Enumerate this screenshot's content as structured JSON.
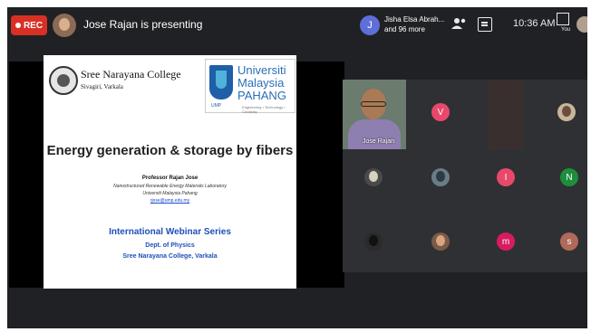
{
  "rec": {
    "label": "REC"
  },
  "presenter": {
    "text": "Jose Rajan is presenting"
  },
  "viewers": {
    "initial": "J",
    "line1": "Jisha Elsa Abrah...",
    "line2": "and 96 more"
  },
  "toolbar": {
    "time": "10:36 AM",
    "self_label": "You"
  },
  "slide": {
    "college_name": "Sree Narayana College",
    "college_place": "Sivagiri, Varkala",
    "ump_text_1": "Universiti",
    "ump_text_2": "Malaysia",
    "ump_text_3": "PAHANG",
    "ump_logo_label": "UMP",
    "ump_tagline": "Engineering • Technology • Creativity",
    "title": "Energy generation & storage by fibers",
    "author": "Professor Rajan Jose",
    "lab": "Nanostructured Renewable Energy Materials Laboratory",
    "university": "Universiti Malaysia Pahang",
    "email": "rjose@ump.edu.my",
    "series": "International Webinar Series",
    "dept": "Dept. of Physics",
    "college_footer": "Sree Narayana College, Varkala"
  },
  "grid": {
    "video_tile_name": "Jose Rajan",
    "tiles": [
      {
        "kind": "letter",
        "text": "V",
        "color": "#e8496a"
      },
      {
        "kind": "letter",
        "text": "I",
        "color": "#e8496a"
      },
      {
        "kind": "letter",
        "text": "N",
        "color": "#1e8e3e"
      },
      {
        "kind": "letter",
        "text": "m",
        "color": "#d81b60"
      },
      {
        "kind": "letter",
        "text": "s",
        "color": "#b06a5a"
      }
    ]
  }
}
